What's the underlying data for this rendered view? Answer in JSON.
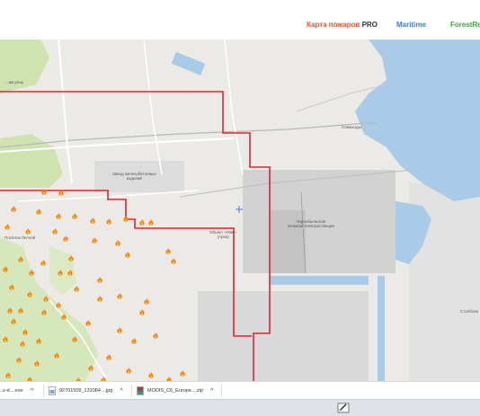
{
  "header": {
    "tab_fire_main": "Карта пожаров",
    "tab_fire_pro": "PRO",
    "tab_maritime": "Maritime",
    "tab_forest": "ForestRep"
  },
  "map": {
    "labels": {
      "factory": "Завод железобетонных\nизделий",
      "semikhody": "Семиходы",
      "npp": "Чернобыльская\nатомная электростанция",
      "object": "Объект «НБК»\n(Арка)",
      "village": "Посёлок Лесной",
      "stolbovo": "Столбово",
      "topleft": "…ам рону"
    },
    "fire_count": 64
  },
  "downloads": {
    "items": [
      {
        "name": "..s-d....exe",
        "icon": "exe-file-icon"
      },
      {
        "name": "92701509_131084....jpg",
        "icon": "image-file-icon"
      },
      {
        "name": "MODIS_C6_Europe....zip",
        "icon": "zip-file-icon"
      }
    ]
  },
  "colors": {
    "boundary": "#e0242b",
    "water": "#a9cbe8",
    "forest": "#cfe3b0",
    "fire": "#ff7a00"
  }
}
